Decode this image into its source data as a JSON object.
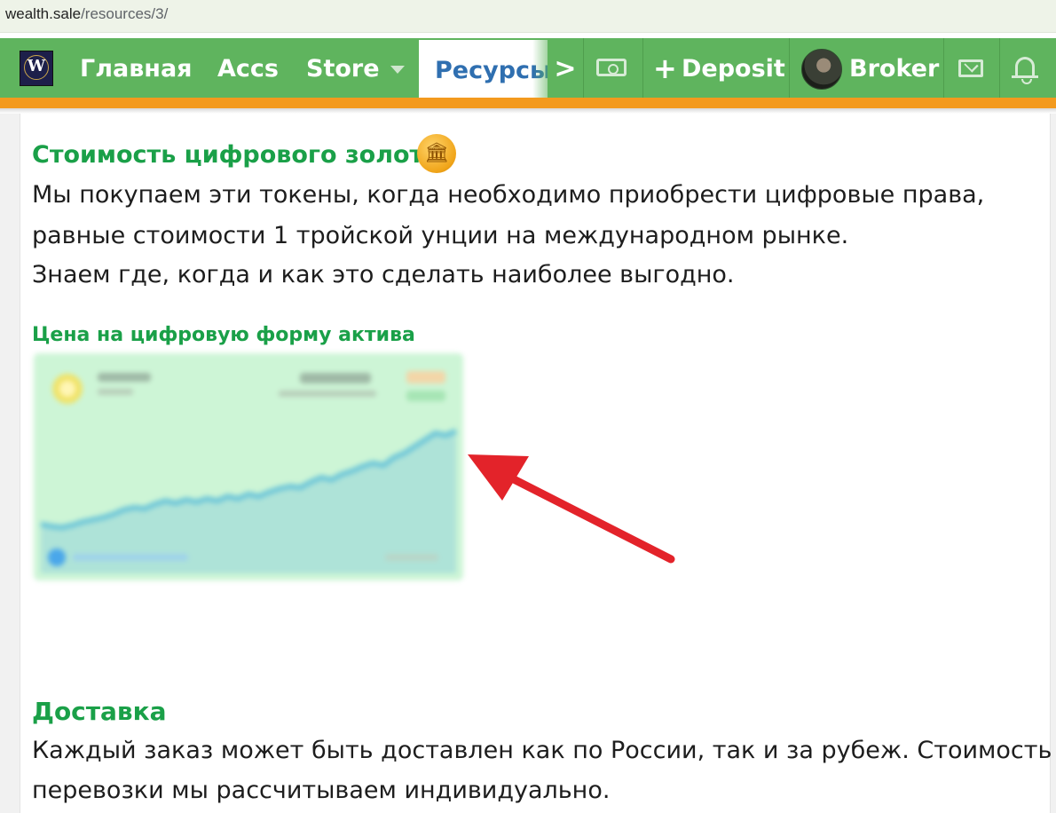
{
  "browser": {
    "url_host": "wealth.sale",
    "url_path": "/resources/3/"
  },
  "nav": {
    "logo_letter": "W",
    "items": [
      {
        "label": "Главная"
      },
      {
        "label": "Accs"
      },
      {
        "label": "Store"
      }
    ],
    "active_tab": "Ресурсы",
    "deposit_label": "Deposit",
    "user_name": "Broker",
    "icons": [
      "money-icon",
      "plus-icon",
      "mail-icon",
      "bell-icon",
      "chevron-right-icon",
      "caret-down-icon"
    ]
  },
  "content": {
    "section1_title": "Стоимость цифрового золота",
    "section1_lines": [
      "Мы покупаем эти токены, когда необходимо приобрести цифровые права,",
      "равные стоимости 1 тройской унции на международном рынке.",
      "Знаем где, когда и как это сделать наиболее выгодно."
    ],
    "price_heading": "Цена на цифровую форму актива",
    "delivery_title": "Доставка",
    "delivery_lines": [
      "Каждый заказ может быть доставлен как по России, так и за рубеж. Стоимость",
      "перевозки мы рассчитываем индивидуально."
    ]
  },
  "colors": {
    "nav_green": "#5fb45e",
    "accent_orange": "#f39a1e",
    "heading_green": "#1aa048",
    "active_tab_text": "#2f6fb0",
    "arrow_red": "#e3232a"
  },
  "chart_data": {
    "type": "area",
    "blurred": true,
    "x": [
      0,
      1,
      2,
      3,
      4,
      5,
      6,
      7,
      8,
      9,
      10,
      11,
      12,
      13,
      14,
      15,
      16,
      17,
      18,
      19,
      20,
      21,
      22,
      23,
      24,
      25,
      26,
      27,
      28,
      29,
      30,
      31,
      32,
      33,
      34,
      35,
      36,
      37,
      38,
      39,
      40
    ],
    "values": [
      10,
      8,
      7,
      9,
      12,
      14,
      16,
      19,
      23,
      25,
      24,
      28,
      31,
      29,
      32,
      30,
      33,
      31,
      35,
      33,
      37,
      35,
      39,
      42,
      44,
      43,
      48,
      52,
      50,
      55,
      58,
      62,
      65,
      63,
      70,
      74,
      80,
      86,
      92,
      90,
      94
    ],
    "ylim": [
      0,
      100
    ]
  }
}
